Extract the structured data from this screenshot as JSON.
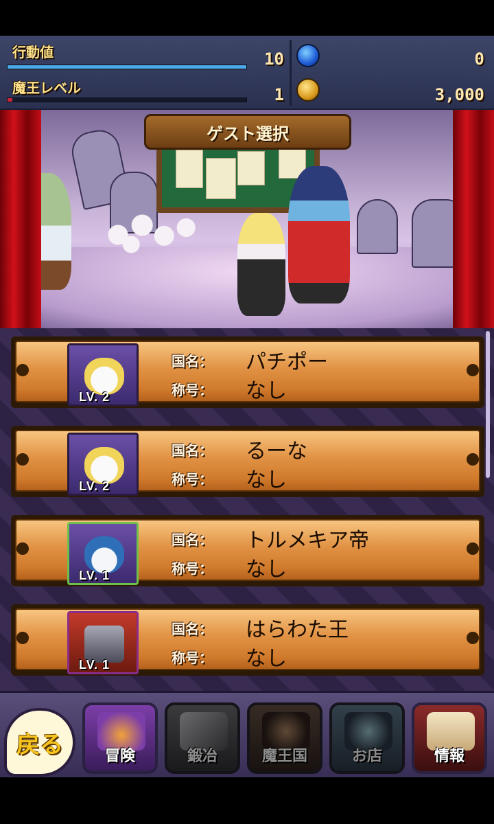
{
  "status": {
    "action_label": "行動値",
    "action_value": "10",
    "action_fill": 1.0,
    "level_label": "魔王レベル",
    "level_value": "1",
    "level_fill": 0.02,
    "gems_value": "0",
    "coins_value": "3,000",
    "colors": {
      "action_bar": "#4aa8e8",
      "level_bar": "#c8283a"
    }
  },
  "scene": {
    "title": "ゲスト選択"
  },
  "guests": [
    {
      "country_label": "国名：",
      "country": "パチポー",
      "title_label": "称号：",
      "title": "なし",
      "level": "LV. 2",
      "avatar": "devil-girl-avatar"
    },
    {
      "country_label": "国名：",
      "country": "るーな",
      "title_label": "称号：",
      "title": "なし",
      "level": "LV. 2",
      "avatar": "devil-girl-avatar"
    },
    {
      "country_label": "国名：",
      "country": "トルメキア帝",
      "title_label": "称号：",
      "title": "なし",
      "level": "LV. 1",
      "avatar": "goggles-ghost-avatar"
    },
    {
      "country_label": "国名：",
      "country": "はらわた王",
      "title_label": "称号：",
      "title": "なし",
      "level": "LV. 1",
      "avatar": "cannon-wagon-avatar"
    }
  ],
  "nav": {
    "back": "戻る",
    "items": [
      {
        "label": "冒険",
        "icon": "adventure-icon",
        "active": true
      },
      {
        "label": "鍛冶",
        "icon": "hammer-icon",
        "active": false
      },
      {
        "label": "魔王国",
        "icon": "demon-kingdom-icon",
        "active": false
      },
      {
        "label": "お店",
        "icon": "shop-icon",
        "active": false
      },
      {
        "label": "情報",
        "icon": "scroll-icon",
        "active": true
      }
    ]
  }
}
